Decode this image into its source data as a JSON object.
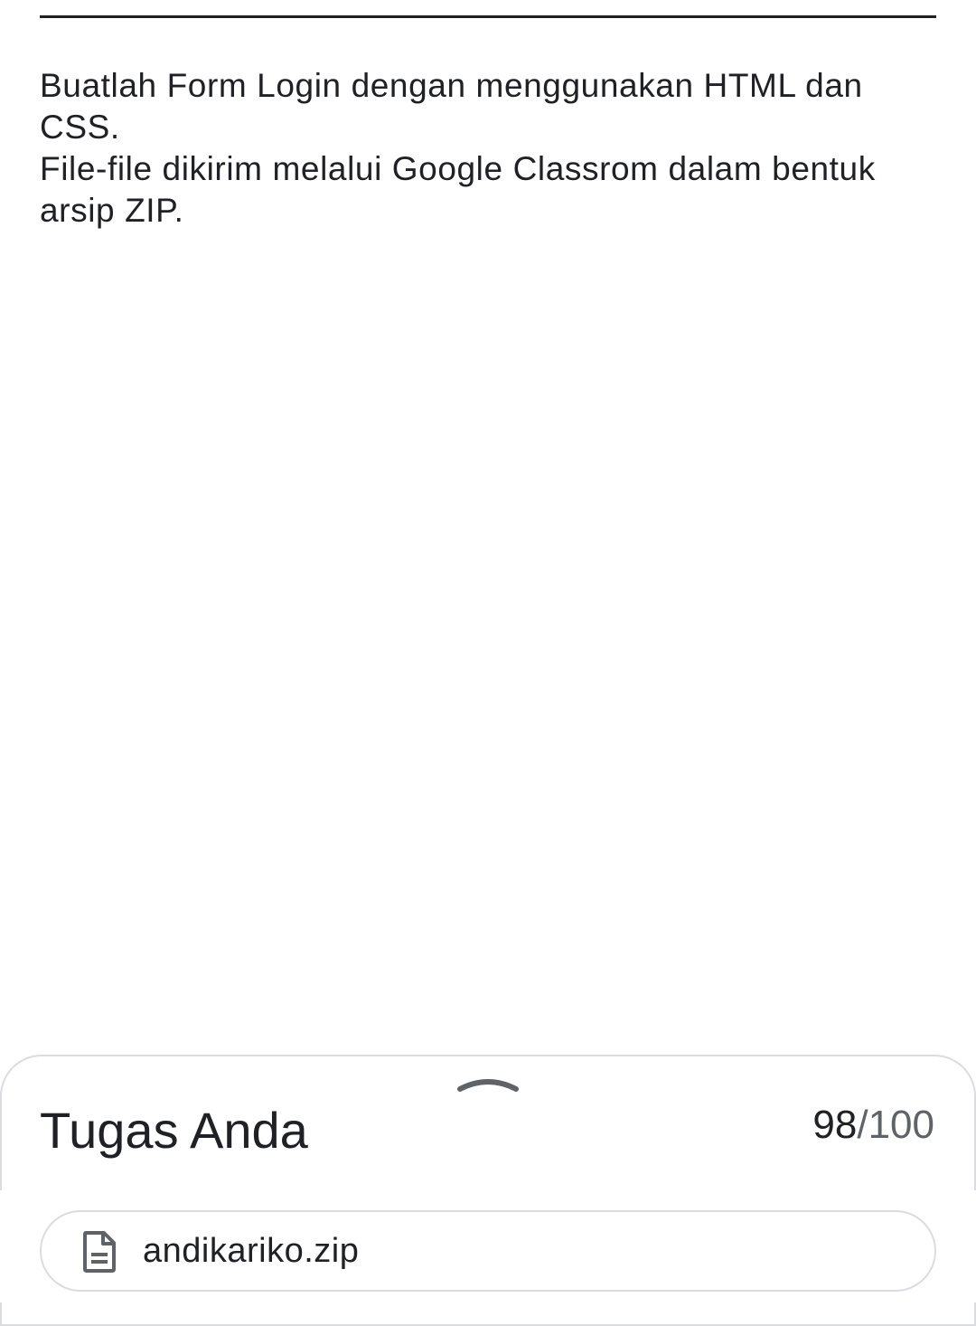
{
  "assignment": {
    "description_lines": [
      "Buatlah Form Login dengan menggunakan HTML dan CSS.",
      "File-file dikirim melalui Google Classrom dalam bentuk arsip ZIP."
    ]
  },
  "your_work": {
    "handle_icon": "chevron-up-icon",
    "title": "Tugas Anda",
    "grade_score": "98",
    "grade_total": "/100",
    "attachment": {
      "icon": "document-icon",
      "file_name": "andikariko.zip"
    }
  },
  "colors": {
    "text_primary": "#202124",
    "text_secondary": "#5f6368",
    "border": "#dadce0",
    "background": "#ffffff"
  }
}
